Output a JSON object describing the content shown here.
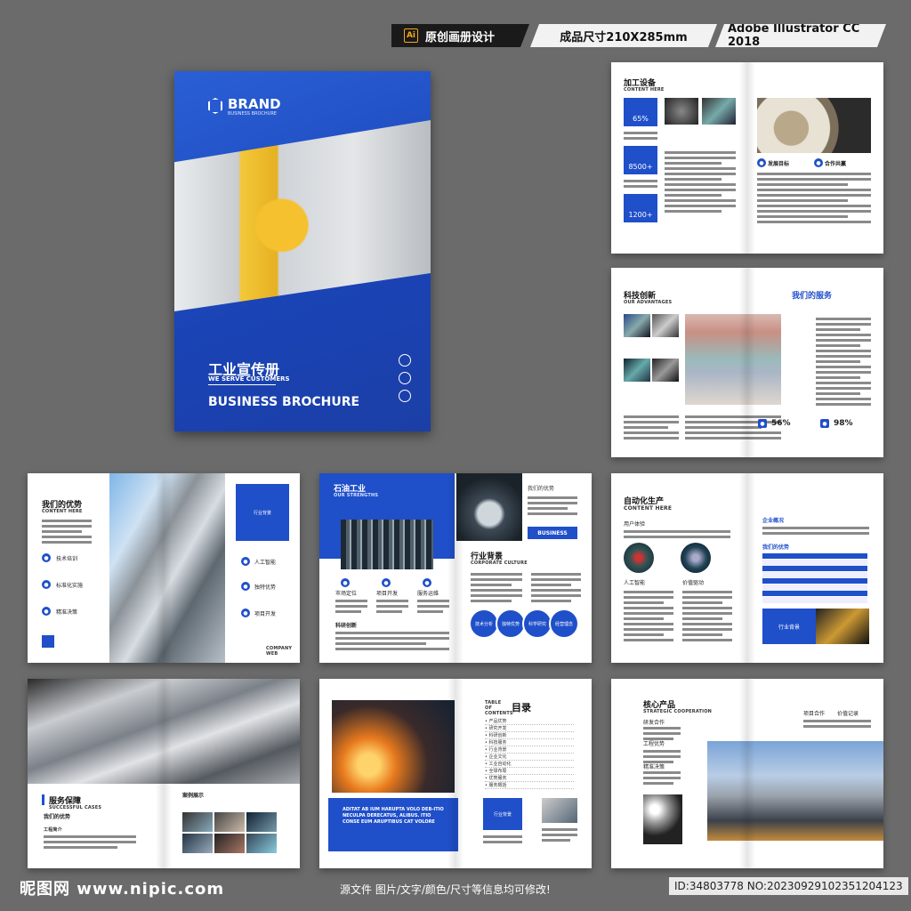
{
  "banner": {
    "ai_badge": "Ai",
    "title": "原创画册设计",
    "size": "成品尺寸210X285mm",
    "software": "Adobe Illustrator CC 2018"
  },
  "cover": {
    "brand": "BRAND",
    "brand_sub": "BUSINESS BROCHURE",
    "title_cn": "工业宣传册",
    "subtitle": "WE SERVE CUSTOMERS",
    "title_en": "BUSINESS BROCHURE"
  },
  "spread1": {
    "heading": "加工设备",
    "sub": "CONTENT HERE",
    "stat1": "65%",
    "stat2": "8500+",
    "stat3": "1200+",
    "goal": "发展目标",
    "coop": "合作共赢"
  },
  "spread2": {
    "heading": "科技创新",
    "sub": "OUR ADVANTAGES",
    "services": "我们的服务",
    "stat1": "56%",
    "stat2": "98%"
  },
  "spread3": {
    "heading": "我们的优势",
    "sub": "CONTENT HERE",
    "item1": "技术培训",
    "item2": "标准化实施",
    "item3": "精准决策",
    "box_label": "行业背景",
    "r1": "人工智能",
    "r2": "独特优势",
    "r3": "项目开发",
    "footer": "COMPANY WEB"
  },
  "spread4": {
    "heading": "石油工业",
    "sub": "OUR STRENGTHS",
    "adv": "我们的优势",
    "business": "BUSINESS",
    "bg": "行业背景",
    "bg_sub": "CORPORATE CULTURE",
    "i1": "市场定位",
    "i2": "项目开发",
    "i3": "服务运维",
    "innov": "科研创新",
    "c1": "技术分析",
    "c2": "独特优势",
    "c3": "科学研究",
    "c4": "经营理念"
  },
  "spread5": {
    "heading": "自动化生产",
    "sub": "CONTENT HERE",
    "user": "用户体验",
    "ai": "人工智能",
    "drive": "价值驱动",
    "overview": "企业概况",
    "adv": "我们的优势",
    "bg": "行业背景"
  },
  "spread6": {
    "heading": "服务保障",
    "sub": "SUCCESSFUL CASES",
    "adv": "我们的优势",
    "cases": "案例展示",
    "small": "工程简介"
  },
  "spread7": {
    "toc_label": "TABLE OF CONTENTS",
    "toc_title": "目录",
    "toc": [
      "产品优势",
      "研究开发",
      "科研创新",
      "科技服务",
      "行业背景",
      "企业文化",
      "工业自动化",
      "全球布局",
      "优势服务",
      "服务概括"
    ],
    "latin": "ADITAT AB IUM HARUPTA VOLO DEB-ITIO NECULPA DERECATUS, ALIBUS. ITIO CONSE EUM ARUPTIBUS CAT VOLORE",
    "bg": "行业背景"
  },
  "spread8": {
    "heading": "核心产品",
    "sub": "STRATEGIC COOPERATION",
    "a": "项目合作",
    "b": "价值记录",
    "c": "研发合作",
    "d": "工程优势",
    "e": "精准决策"
  },
  "footer": {
    "site": "昵图网 www.nipic.com",
    "note": "源文件 图片/文字/颜色/尺寸等信息均可修改!",
    "id": "ID:34803778 NO:20230929102351204123"
  },
  "colors": {
    "accent": "#1f4fc9",
    "background": "#6b6b6b"
  }
}
